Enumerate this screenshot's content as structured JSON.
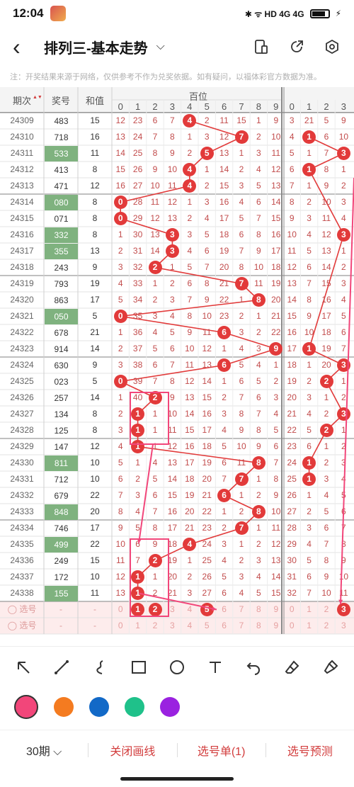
{
  "status": {
    "time": "12:04",
    "right": "✱ ᯤ HD 4G 4G"
  },
  "header": {
    "title": "排列三-基本走势"
  },
  "notice": "注：开奖结果来源于网络，仅供参考不作为兑奖依据。如有疑问，以福体彩官方数据为准。",
  "table": {
    "col_period": "期次",
    "col_award": "奖号",
    "col_sum": "和值",
    "group_hundreds": "百位",
    "digits": [
      "0",
      "1",
      "2",
      "3",
      "4",
      "5",
      "6",
      "7",
      "8",
      "9"
    ],
    "digits2": [
      "0",
      "1",
      "2",
      "3"
    ],
    "pick_label": "选号",
    "pick_dash": "-",
    "rows": [
      {
        "p": "24309",
        "a": "483",
        "s": "15",
        "hl": false,
        "m": [
          12,
          23,
          6,
          7,
          null,
          2,
          11,
          15,
          1,
          9
        ],
        "h": 4,
        "t": [
          3,
          21,
          5,
          9
        ]
      },
      {
        "p": "24310",
        "a": "718",
        "s": "16",
        "hl": false,
        "m": [
          13,
          24,
          7,
          8,
          1,
          3,
          12,
          null,
          2,
          10
        ],
        "h": 7,
        "t": [
          4,
          null,
          6,
          10
        ],
        "t1": 1
      },
      {
        "p": "24311",
        "a": "533",
        "s": "11",
        "hl": true,
        "m": [
          14,
          25,
          8,
          9,
          2,
          null,
          13,
          1,
          3,
          11
        ],
        "h": 5,
        "t": [
          5,
          1,
          7,
          null
        ],
        "t3": 3
      },
      {
        "p": "24312",
        "a": "413",
        "s": "8",
        "hl": false,
        "m": [
          15,
          26,
          9,
          10,
          null,
          1,
          14,
          2,
          4,
          12
        ],
        "h": 4,
        "t": [
          6,
          null,
          8,
          1
        ],
        "t1": 1
      },
      {
        "p": "24313",
        "a": "471",
        "s": "12",
        "hl": false,
        "m": [
          16,
          27,
          10,
          11,
          null,
          2,
          15,
          3,
          5,
          13
        ],
        "h": 4,
        "t": [
          7,
          1,
          9,
          2
        ]
      },
      {
        "p": "24314",
        "a": "080",
        "s": "8",
        "hl": true,
        "m": [
          null,
          28,
          11,
          12,
          1,
          3,
          16,
          4,
          6,
          14
        ],
        "h": 0,
        "t": [
          8,
          2,
          10,
          3
        ]
      },
      {
        "p": "24315",
        "a": "071",
        "s": "8",
        "hl": false,
        "m": [
          null,
          29,
          12,
          13,
          2,
          4,
          17,
          5,
          7,
          15
        ],
        "h": 0,
        "t": [
          9,
          3,
          11,
          4
        ]
      },
      {
        "p": "24316",
        "a": "332",
        "s": "8",
        "hl": true,
        "m": [
          1,
          30,
          13,
          null,
          3,
          5,
          18,
          6,
          8,
          16
        ],
        "h": 3,
        "t": [
          10,
          4,
          12,
          null
        ],
        "t3": 3
      },
      {
        "p": "24317",
        "a": "355",
        "s": "13",
        "hl": true,
        "m": [
          2,
          31,
          14,
          null,
          4,
          6,
          19,
          7,
          9,
          17
        ],
        "h": 3,
        "t": [
          11,
          5,
          13,
          1
        ]
      },
      {
        "p": "24318",
        "a": "243",
        "s": "9",
        "hl": false,
        "m": [
          3,
          32,
          null,
          1,
          5,
          7,
          20,
          8,
          10,
          18
        ],
        "h": 2,
        "t": [
          12,
          6,
          14,
          2
        ]
      },
      {
        "p": "24319",
        "a": "793",
        "s": "19",
        "hl": false,
        "m": [
          4,
          33,
          1,
          2,
          6,
          8,
          21,
          null,
          11,
          19
        ],
        "h": 7,
        "t": [
          13,
          7,
          15,
          3
        ]
      },
      {
        "p": "24320",
        "a": "863",
        "s": "17",
        "hl": false,
        "m": [
          5,
          34,
          2,
          3,
          7,
          9,
          22,
          1,
          null,
          20
        ],
        "h": 8,
        "t": [
          14,
          8,
          16,
          4
        ]
      },
      {
        "p": "24321",
        "a": "050",
        "s": "5",
        "hl": true,
        "m": [
          null,
          35,
          3,
          4,
          8,
          10,
          23,
          2,
          1,
          21
        ],
        "h": 0,
        "t": [
          15,
          9,
          17,
          5
        ]
      },
      {
        "p": "24322",
        "a": "678",
        "s": "21",
        "hl": false,
        "m": [
          1,
          36,
          4,
          5,
          9,
          11,
          null,
          3,
          2,
          22
        ],
        "h": 6,
        "t": [
          16,
          10,
          18,
          6
        ]
      },
      {
        "p": "24323",
        "a": "914",
        "s": "14",
        "hl": false,
        "m": [
          2,
          37,
          5,
          6,
          10,
          12,
          1,
          4,
          3,
          null
        ],
        "h": 9,
        "t": [
          17,
          null,
          19,
          7
        ],
        "t1": 1
      },
      {
        "p": "24324",
        "a": "630",
        "s": "9",
        "hl": false,
        "m": [
          3,
          38,
          6,
          7,
          11,
          13,
          null,
          5,
          4,
          1
        ],
        "h": 6,
        "t": [
          18,
          1,
          20,
          null
        ],
        "t3": 3
      },
      {
        "p": "24325",
        "a": "023",
        "s": "5",
        "hl": false,
        "m": [
          null,
          39,
          7,
          8,
          12,
          14,
          1,
          6,
          5,
          2
        ],
        "h": 0,
        "t": [
          19,
          2,
          null,
          1
        ],
        "t2": 2
      },
      {
        "p": "24326",
        "a": "257",
        "s": "14",
        "hl": false,
        "m": [
          1,
          40,
          null,
          9,
          13,
          15,
          2,
          7,
          6,
          3
        ],
        "h": 2,
        "t": [
          20,
          3,
          1,
          2
        ]
      },
      {
        "p": "24327",
        "a": "134",
        "s": "8",
        "hl": false,
        "m": [
          2,
          null,
          1,
          10,
          14,
          16,
          3,
          8,
          7,
          4
        ],
        "h": 1,
        "t": [
          21,
          4,
          2,
          null
        ],
        "t3": 3
      },
      {
        "p": "24328",
        "a": "125",
        "s": "8",
        "hl": false,
        "m": [
          3,
          null,
          1,
          11,
          15,
          17,
          4,
          9,
          8,
          5
        ],
        "h": 1,
        "t": [
          22,
          5,
          null,
          1
        ],
        "t2": 2
      },
      {
        "p": "24329",
        "a": "147",
        "s": "12",
        "hl": false,
        "m": [
          4,
          null,
          1,
          12,
          16,
          18,
          5,
          10,
          9,
          6
        ],
        "h": 1,
        "t": [
          23,
          6,
          1,
          2
        ]
      },
      {
        "p": "24330",
        "a": "811",
        "s": "10",
        "hl": true,
        "m": [
          5,
          1,
          4,
          13,
          17,
          19,
          6,
          11,
          null,
          7
        ],
        "h": 8,
        "t": [
          24,
          null,
          2,
          3
        ],
        "t1": 1
      },
      {
        "p": "24331",
        "a": "712",
        "s": "10",
        "hl": false,
        "m": [
          6,
          2,
          5,
          14,
          18,
          20,
          7,
          null,
          1,
          8
        ],
        "h": 7,
        "t": [
          25,
          null,
          3,
          4
        ],
        "t1": 1
      },
      {
        "p": "24332",
        "a": "679",
        "s": "22",
        "hl": false,
        "m": [
          7,
          3,
          6,
          15,
          19,
          21,
          null,
          1,
          2,
          9
        ],
        "h": 6,
        "t": [
          26,
          1,
          4,
          5
        ]
      },
      {
        "p": "24333",
        "a": "848",
        "s": "20",
        "hl": true,
        "m": [
          8,
          4,
          7,
          16,
          20,
          22,
          1,
          2,
          null,
          10
        ],
        "h": 8,
        "t": [
          27,
          2,
          5,
          6
        ]
      },
      {
        "p": "24334",
        "a": "746",
        "s": "17",
        "hl": false,
        "m": [
          9,
          5,
          8,
          17,
          21,
          23,
          2,
          null,
          1,
          11
        ],
        "h": 7,
        "t": [
          28,
          3,
          6,
          7
        ]
      },
      {
        "p": "24335",
        "a": "499",
        "s": "22",
        "hl": true,
        "m": [
          10,
          6,
          9,
          18,
          null,
          24,
          3,
          1,
          2,
          12
        ],
        "h": 4,
        "t": [
          29,
          4,
          7,
          8
        ]
      },
      {
        "p": "24336",
        "a": "249",
        "s": "15",
        "hl": false,
        "m": [
          11,
          7,
          null,
          19,
          1,
          25,
          4,
          2,
          3,
          13
        ],
        "h": 2,
        "t": [
          30,
          5,
          8,
          9
        ]
      },
      {
        "p": "24337",
        "a": "172",
        "s": "10",
        "hl": false,
        "m": [
          12,
          null,
          1,
          20,
          2,
          26,
          5,
          3,
          4,
          14
        ],
        "h": 1,
        "t": [
          31,
          6,
          9,
          10
        ]
      },
      {
        "p": "24338",
        "a": "155",
        "s": "11",
        "hl": true,
        "m": [
          13,
          null,
          2,
          21,
          3,
          27,
          6,
          4,
          5,
          15
        ],
        "h": 1,
        "t": [
          32,
          7,
          10,
          11
        ]
      }
    ],
    "pick_rows": [
      {
        "vals": [
          0,
          null,
          null,
          3,
          4,
          null,
          6,
          7,
          8,
          9
        ],
        "dots": [
          1,
          2,
          5
        ],
        "t": [
          0,
          1,
          2,
          null
        ],
        "t3": 3
      },
      {
        "vals": [
          0,
          1,
          2,
          3,
          4,
          5,
          6,
          7,
          8,
          9
        ],
        "dots": [],
        "t": [
          0,
          1,
          2,
          3
        ]
      }
    ]
  },
  "colors": [
    "#f2467a",
    "#f47b20",
    "#1269c7",
    "#1fc18a",
    "#9a22e0"
  ],
  "bottom": {
    "period": "30期 ⌵",
    "close": "关闭画线",
    "picks": "选号单(1)",
    "predict": "选号预测"
  }
}
